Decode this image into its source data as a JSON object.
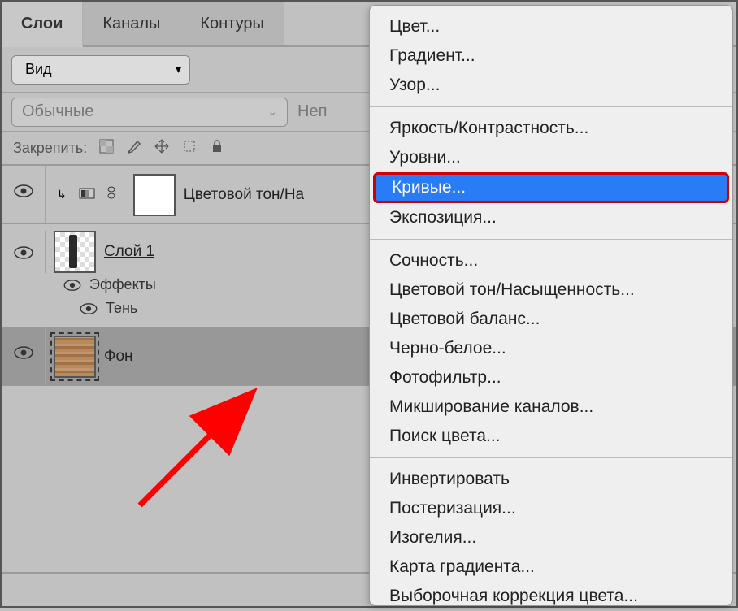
{
  "tabs": {
    "layers": "Слои",
    "channels": "Каналы",
    "paths": "Контуры"
  },
  "toolbar": {
    "filter_label": "Вид"
  },
  "blend": {
    "mode": "Обычные",
    "opacity_label": "Неп"
  },
  "lock": {
    "label": "Закрепить:"
  },
  "layers_list": {
    "adj": {
      "name": "Цветовой тон/На"
    },
    "l1": {
      "name": "Слой 1",
      "effects": "Эффекты",
      "shadow": "Тень"
    },
    "bg": {
      "name": "Фон"
    }
  },
  "menu": {
    "color": "Цвет...",
    "gradient": "Градиент...",
    "pattern": "Узор...",
    "brightness": "Яркость/Контрастность...",
    "levels": "Уровни...",
    "curves": "Кривые...",
    "exposure": "Экспозиция...",
    "vibrance": "Сочность...",
    "hue": "Цветовой тон/Насыщенность...",
    "colorbal": "Цветовой баланс...",
    "bw": "Черно-белое...",
    "photofilter": "Фотофильтр...",
    "channelmix": "Микширование каналов...",
    "colorlookup": "Поиск цвета...",
    "invert": "Инвертировать",
    "posterize": "Постеризация...",
    "threshold": "Изогелия...",
    "gradmap": "Карта градиента...",
    "selective": "Выборочная коррекция цвета..."
  }
}
